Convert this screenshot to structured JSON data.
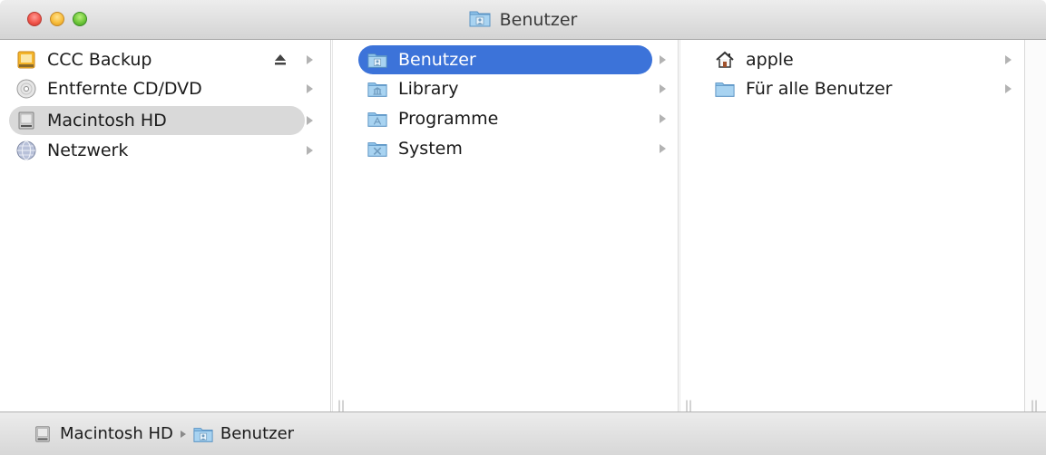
{
  "window": {
    "title": "Benutzer"
  },
  "column1": {
    "items": [
      {
        "label": "CCC Backup",
        "icon": "external-drive-icon",
        "eject": true,
        "selected": false
      },
      {
        "label": "Entfernte CD/DVD",
        "icon": "cd-icon",
        "selected": false
      },
      {
        "label": "Macintosh HD",
        "icon": "hard-drive-icon",
        "selected": true
      },
      {
        "label": "Netzwerk",
        "icon": "network-globe-icon",
        "selected": false
      }
    ]
  },
  "column2": {
    "items": [
      {
        "label": "Benutzer",
        "icon": "users-folder-icon",
        "selected": true
      },
      {
        "label": "Library",
        "icon": "library-folder-icon",
        "selected": false
      },
      {
        "label": "Programme",
        "icon": "applications-folder-icon",
        "selected": false
      },
      {
        "label": "System",
        "icon": "system-folder-icon",
        "selected": false
      }
    ]
  },
  "column3": {
    "items": [
      {
        "label": "apple",
        "icon": "home-icon",
        "selected": false
      },
      {
        "label": "Für alle Benutzer",
        "icon": "folder-icon",
        "selected": false
      }
    ]
  },
  "pathbar": {
    "segments": [
      {
        "label": "Macintosh HD",
        "icon": "hard-drive-icon"
      },
      {
        "label": "Benutzer",
        "icon": "users-folder-icon"
      }
    ]
  },
  "colors": {
    "selection_blue": "#3c73d9",
    "selection_gray": "#d9d9d9"
  }
}
